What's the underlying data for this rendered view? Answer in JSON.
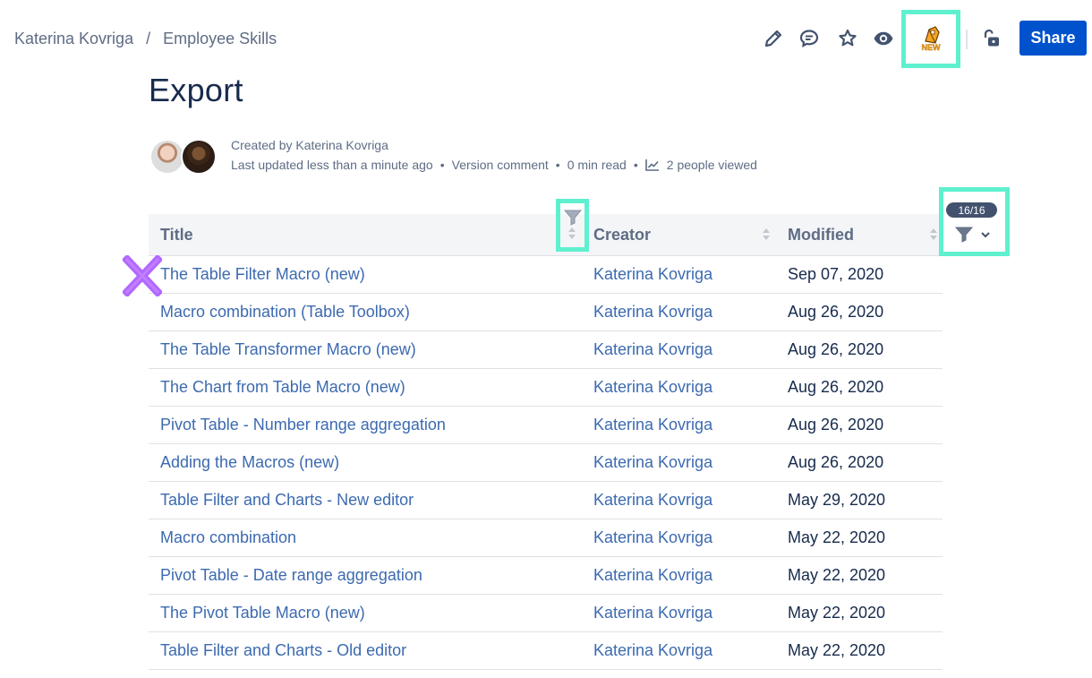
{
  "breadcrumb": {
    "items": [
      "Katerina Kovriga",
      "Employee Skills"
    ],
    "separator": "/"
  },
  "toolbar": {
    "icons": [
      "edit-icon",
      "comment-icon",
      "star-icon",
      "watch-icon",
      "new-app-icon",
      "restrictions-icon"
    ],
    "new_badge": "NEW",
    "share_label": "Share",
    "accent_color": "#0052cc",
    "highlight_color": "#5ef0cf"
  },
  "page": {
    "title": "Export",
    "created_by": "Created by Katerina Kovriga",
    "last_updated": "Last updated less than a minute ago",
    "version_comment": "Version comment",
    "read_time": "0 min read",
    "views": "2 people viewed"
  },
  "table": {
    "filter_count": "16/16",
    "columns": [
      "Title",
      "Creator",
      "Modified"
    ],
    "rows": [
      {
        "title": "The Table Filter Macro (new)",
        "creator": "Katerina Kovriga",
        "modified": "Sep 07, 2020"
      },
      {
        "title": "Macro combination (Table Toolbox)",
        "creator": "Katerina Kovriga",
        "modified": "Aug 26, 2020"
      },
      {
        "title": "The Table Transformer Macro (new)",
        "creator": "Katerina Kovriga",
        "modified": "Aug 26, 2020"
      },
      {
        "title": "The Chart from Table Macro (new)",
        "creator": "Katerina Kovriga",
        "modified": "Aug 26, 2020"
      },
      {
        "title": "Pivot Table - Number range aggregation",
        "creator": "Katerina Kovriga",
        "modified": "Aug 26, 2020"
      },
      {
        "title": "Adding the Macros (new)",
        "creator": "Katerina Kovriga",
        "modified": "Aug 26, 2020"
      },
      {
        "title": "Table Filter and Charts - New editor",
        "creator": "Katerina Kovriga",
        "modified": "May 29, 2020"
      },
      {
        "title": "Macro combination",
        "creator": "Katerina Kovriga",
        "modified": "May 22, 2020"
      },
      {
        "title": "Pivot Table - Date range aggregation",
        "creator": "Katerina Kovriga",
        "modified": "May 22, 2020"
      },
      {
        "title": "The Pivot Table Macro (new)",
        "creator": "Katerina Kovriga",
        "modified": "May 22, 2020"
      },
      {
        "title": "Table Filter and Charts - Old editor",
        "creator": "Katerina Kovriga",
        "modified": "May 22, 2020"
      }
    ]
  }
}
